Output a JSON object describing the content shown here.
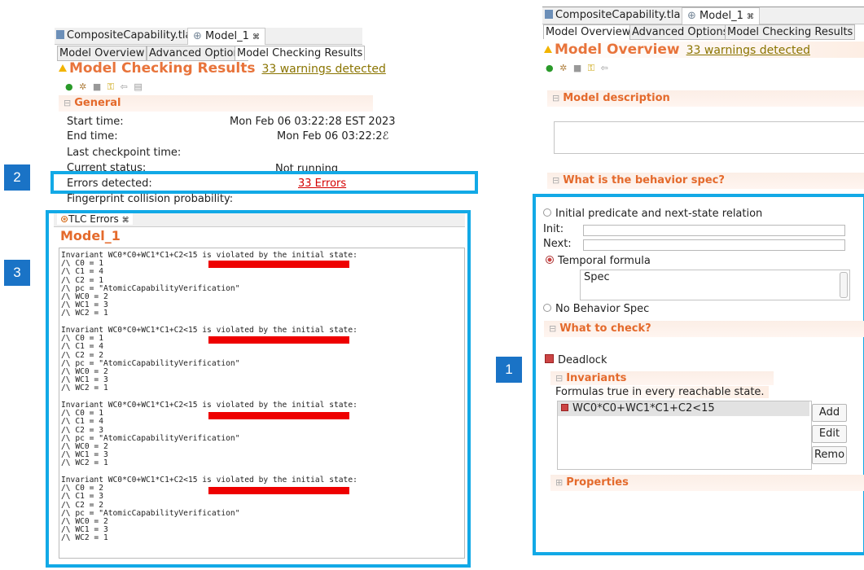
{
  "left": {
    "editor_tabs": [
      "CompositeCapability.tla",
      "Model_1"
    ],
    "subtabs": [
      "Model Overview",
      "Advanced Options",
      "Model Checking Results"
    ],
    "title": "Model Checking Results",
    "warnings": "33 warnings detected",
    "general": {
      "header": "General",
      "rows": [
        {
          "label": "Start time:",
          "value": "Mon Feb 06 03:22:28 EST 2023"
        },
        {
          "label": "End time:",
          "value": "Mon Feb 06 03:22:2ℰ"
        },
        {
          "label": "Last checkpoint time:",
          "value": ""
        },
        {
          "label": "Current status:",
          "value": "Not running"
        },
        {
          "label": "Errors detected:",
          "value": "33 Errors"
        },
        {
          "label": "Fingerprint collision probability:",
          "value": ""
        }
      ]
    },
    "tlc_errors": {
      "tab_label": "TLC Errors",
      "model": "Model_1",
      "trace_blocks": [
        "Invariant WC0*C0+WC1*C1+C2<15 is violated by the initial state:\n/\\ C0 = 1\n/\\ C1 = 4\n/\\ C2 = 1\n/\\ pc = \"AtomicCapabilityVerification\"\n/\\ WC0 = 2\n/\\ WC1 = 3\n/\\ WC2 = 1",
        "Invariant WC0*C0+WC1*C1+C2<15 is violated by the initial state:\n/\\ C0 = 1\n/\\ C1 = 4\n/\\ C2 = 2\n/\\ pc = \"AtomicCapabilityVerification\"\n/\\ WC0 = 2\n/\\ WC1 = 3\n/\\ WC2 = 1",
        "Invariant WC0*C0+WC1*C1+C2<15 is violated by the initial state:\n/\\ C0 = 1\n/\\ C1 = 4\n/\\ C2 = 3\n/\\ pc = \"AtomicCapabilityVerification\"\n/\\ WC0 = 2\n/\\ WC1 = 3\n/\\ WC2 = 1",
        "Invariant WC0*C0+WC1*C1+C2<15 is violated by the initial state:\n/\\ C0 = 2\n/\\ C1 = 3\n/\\ C2 = 2\n/\\ pc = \"AtomicCapabilityVerification\"\n/\\ WC0 = 2\n/\\ WC1 = 3\n/\\ WC2 = 1"
      ]
    }
  },
  "right": {
    "editor_tabs": [
      "CompositeCapability.tla",
      "Model_1"
    ],
    "subtabs": [
      "Model Overview",
      "Advanced Options",
      "Model Checking Results"
    ],
    "title": "Model Overview",
    "warnings": "33 warnings detected",
    "model_description": "Model description",
    "behavior_header": "What is the behavior spec?",
    "initial_next": "Initial predicate and next-state relation",
    "init_label": "Init:",
    "next_label": "Next:",
    "temporal": "Temporal formula",
    "spec_value": "Spec",
    "no_behavior": "No Behavior Spec",
    "what_to_check": "What to check?",
    "deadlock": "Deadlock",
    "invariants_header": "Invariants",
    "invariants_desc": "Formulas true in every reachable state.",
    "invariant_item": "WC0*C0+WC1*C1+C2<15",
    "btn_add": "Add",
    "btn_edit": "Edit",
    "btn_remove": "Remo",
    "properties": "Properties"
  },
  "badges": [
    "1",
    "2",
    "3"
  ],
  "colors": {
    "highlight_box": "#12a9e6",
    "badge": "#1a73c6",
    "redaction": "#ee0000",
    "section_title": "#e46a2c",
    "error_link": "#d40000"
  }
}
